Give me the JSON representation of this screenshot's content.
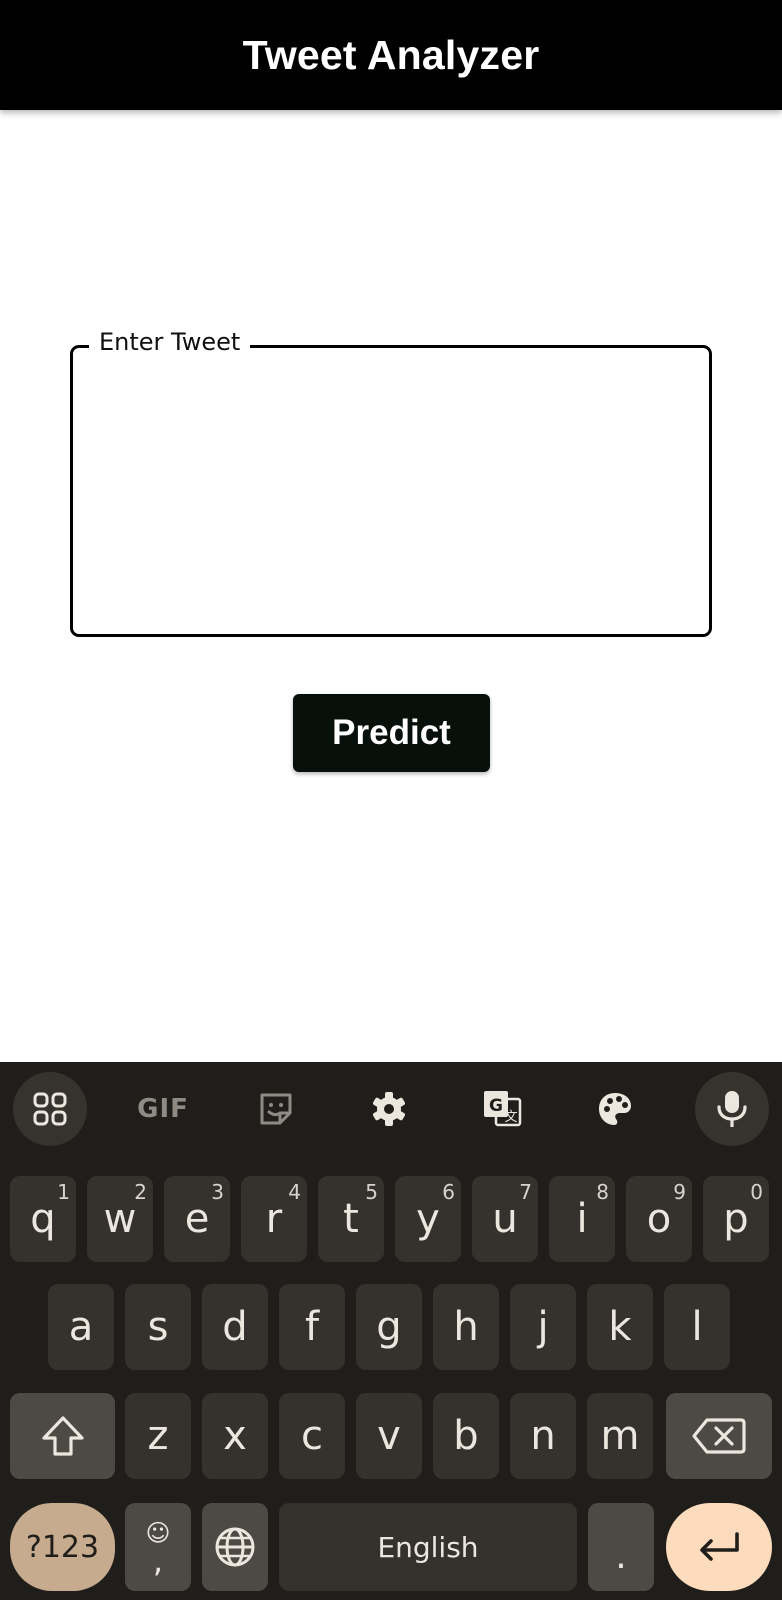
{
  "app": {
    "title": "Tweet Analyzer"
  },
  "form": {
    "tweet_label": "Enter Tweet",
    "tweet_value": "",
    "predict_label": "Predict"
  },
  "keyboard": {
    "toolbar": [
      "apps-icon",
      "gif-icon",
      "sticker-icon",
      "settings-icon",
      "translate-icon",
      "palette-icon",
      "mic-icon"
    ],
    "gif_label": "GIF",
    "row1": [
      {
        "k": "q",
        "h": "1"
      },
      {
        "k": "w",
        "h": "2"
      },
      {
        "k": "e",
        "h": "3"
      },
      {
        "k": "r",
        "h": "4"
      },
      {
        "k": "t",
        "h": "5"
      },
      {
        "k": "y",
        "h": "6"
      },
      {
        "k": "u",
        "h": "7"
      },
      {
        "k": "i",
        "h": "8"
      },
      {
        "k": "o",
        "h": "9"
      },
      {
        "k": "p",
        "h": "0"
      }
    ],
    "row2": [
      "a",
      "s",
      "d",
      "f",
      "g",
      "h",
      "j",
      "k",
      "l"
    ],
    "row3": [
      "z",
      "x",
      "c",
      "v",
      "b",
      "n",
      "m"
    ],
    "symbols_label": "?123",
    "comma_label": ",",
    "space_label": "English",
    "period_label": ".",
    "colors": {
      "background": "#201e1b",
      "key": "#35322e",
      "special": "#4d4944",
      "symbols": "#c7ab8e",
      "enter": "#fddcbd"
    }
  }
}
